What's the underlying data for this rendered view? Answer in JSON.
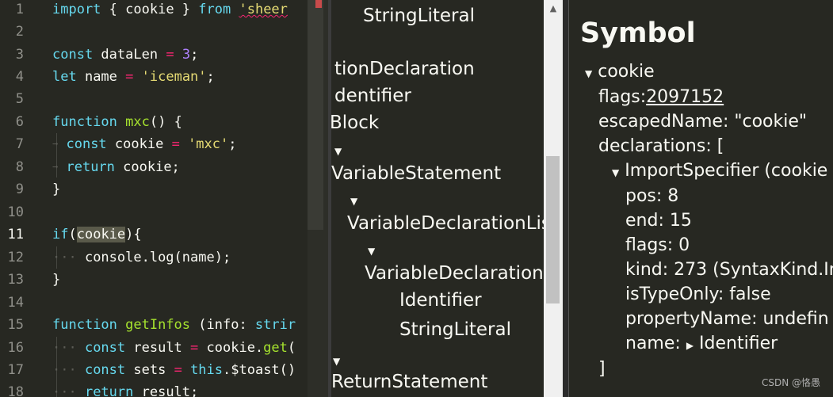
{
  "editor": {
    "line_numbers": [
      "1",
      "2",
      "3",
      "4",
      "5",
      "6",
      "7",
      "8",
      "9",
      "10",
      "11",
      "12",
      "13",
      "14",
      "15",
      "16",
      "17",
      "18"
    ],
    "active_line": "11",
    "lines": {
      "l1": {
        "kw1": "import",
        "p1": " { ",
        "p2": "cookie",
        "p3": " } ",
        "kw2": "from",
        "p4": " ",
        "s1": "'sheer"
      },
      "l3": {
        "kw": "const",
        "name": " dataLen ",
        "op": "=",
        "sp": " ",
        "num": "3",
        "end": ";"
      },
      "l4": {
        "kw": "let",
        "name": " name ",
        "op": "=",
        "sp": " ",
        "str": "'iceman'",
        "end": ";"
      },
      "l6": {
        "kw": "function",
        "sp": " ",
        "fn": "mxc",
        "end": "() {"
      },
      "l7": {
        "kw": "const",
        "name": " cookie ",
        "op": "=",
        "sp": " ",
        "str": "'mxc'",
        "end": ";"
      },
      "l8": {
        "kw": "return",
        "rest": " cookie;"
      },
      "l9": {
        "text": "}"
      },
      "l11": {
        "kw": "if",
        "open": "(",
        "hl": "cookie",
        "close": "){"
      },
      "l12": {
        "text": "console.log(name);"
      },
      "l13": {
        "text": "}"
      },
      "l15": {
        "kw": "function",
        "sp": " ",
        "fn": "getInfos",
        "rest": " (info: ",
        "kw2": "strir"
      },
      "l16": {
        "kw": "const",
        "name": " result ",
        "op": "=",
        "rest": " cookie.",
        "fn": "get",
        "end": "("
      },
      "l17": {
        "kw": "const",
        "name": " sets ",
        "op": "=",
        "sp": " ",
        "kw2": "this",
        "rest": ".$toast()"
      },
      "l18": {
        "kw": "return",
        "rest": " result;"
      }
    }
  },
  "ast_tree": {
    "n1": "StringLiteral",
    "n2": "tionDeclaration",
    "n3": "dentifier",
    "n4": "Block",
    "n5": "VariableStatement",
    "n6": "VariableDeclarationLis",
    "n7": "VariableDeclaration",
    "n8": "Identifier",
    "n9": "StringLiteral",
    "n10": "ReturnStatement"
  },
  "symbol_panel": {
    "title": "Symbol",
    "root": "cookie",
    "flags_label": "flags:",
    "flags_value": "2097152",
    "escaped_label": "escapedName:",
    "escaped_value": "\"cookie\"",
    "decl_label": "declarations: [",
    "import_spec": "ImportSpecifier (cookie",
    "pos": "pos: 8",
    "end": "end: 15",
    "flags0": "flags: 0",
    "kind": "kind: 273 (SyntaxKind.Im",
    "isTypeOnly": "isTypeOnly: false",
    "propertyName": "propertyName: undefin",
    "name_label": "name:",
    "name_value": "Identifier",
    "close": "]"
  },
  "watermark": "CSDN @恪愚",
  "colors": {
    "editor_bg": "#272822",
    "keyword": "#66d9ef",
    "function": "#a6e22e",
    "string": "#e6db74",
    "number": "#ae81ff",
    "operator": "#f92672"
  }
}
